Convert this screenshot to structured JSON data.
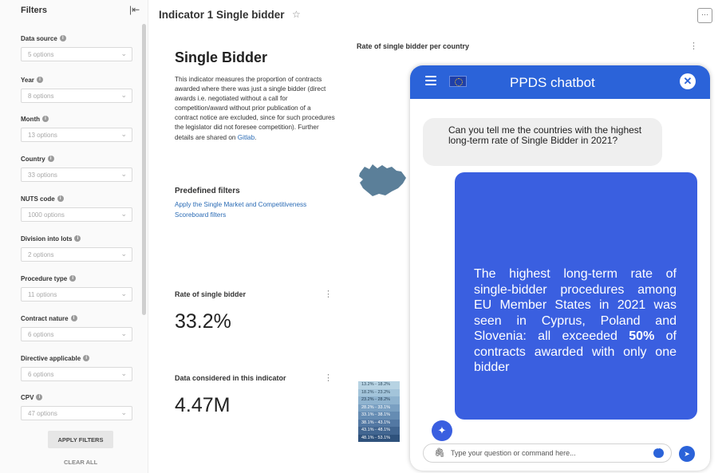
{
  "sidebar": {
    "title": "Filters",
    "collapse_icon": "collapse-left-icon",
    "filters": [
      {
        "label": "Data source",
        "value": "5 options"
      },
      {
        "label": "Year",
        "value": "8 options"
      },
      {
        "label": "Month",
        "value": "13 options"
      },
      {
        "label": "Country",
        "value": "33 options"
      },
      {
        "label": "NUTS code",
        "value": "1000 options"
      },
      {
        "label": "Division into lots",
        "value": "2 options"
      },
      {
        "label": "Procedure type",
        "value": "11 options"
      },
      {
        "label": "Contract nature",
        "value": "6 options"
      },
      {
        "label": "Directive applicable",
        "value": "6 options"
      },
      {
        "label": "CPV",
        "value": "47 options"
      }
    ],
    "apply_label": "APPLY FILTERS",
    "clear_label": "CLEAR ALL"
  },
  "header": {
    "title": "Indicator 1 Single bidder",
    "star_icon": "☆",
    "more_icon": "···"
  },
  "card": {
    "title": "Single Bidder",
    "description": "This indicator measures the proportion of contracts awarded where there was just a single bidder (direct awards i.e. negotiated without a call for competition/award without prior publication of a contract notice are excluded, since for such procedures the legislator did not foresee competition). Further details are shared on ",
    "description_link": "Gitlab",
    "description_end": ".",
    "predefined_title": "Predefined filters",
    "predefined_link": "Apply the Single Market and Competitiveness Scoreboard filters"
  },
  "metrics": {
    "rate_title": "Rate of single bidder",
    "rate_value": "33.2%",
    "data_title": "Data considered in this indicator",
    "data_value": "4.47M"
  },
  "map": {
    "title": "Rate of single bidder per country",
    "legend": [
      {
        "label": "13.2% - 18.2%",
        "color": "#b7d3e3"
      },
      {
        "label": "18.2% - 23.2%",
        "color": "#a3c4da"
      },
      {
        "label": "23.2% - 28.2%",
        "color": "#8fb3cf"
      },
      {
        "label": "28.2% - 33.1%",
        "color": "#7aa0c2"
      },
      {
        "label": "33.1% - 38.1%",
        "color": "#658cb3"
      },
      {
        "label": "38.1% - 43.1%",
        "color": "#5378a3"
      },
      {
        "label": "43.1% - 48.1%",
        "color": "#416590"
      },
      {
        "label": "48.1% - 53.1%",
        "color": "#2f527c"
      }
    ]
  },
  "chat": {
    "title": "PPDS chatbot",
    "close_icon": "✕",
    "user_message": "Can you tell me the countries with the highest long-term rate of Single Bidder in 2021?",
    "bot_message_before": "The highest long-term rate of single-bidder procedures among EU Member States in 2021 was seen in Cyprus, Poland and Slovenia: all exceeded ",
    "bot_message_bold": "50%",
    "bot_message_after": " of contracts awarded with only one bidder",
    "input_placeholder": "Type your question or command here...",
    "colors": {
      "header": "#2b63d9",
      "bot_bubble": "#3a5fe0",
      "user_bubble": "#efefef"
    }
  }
}
